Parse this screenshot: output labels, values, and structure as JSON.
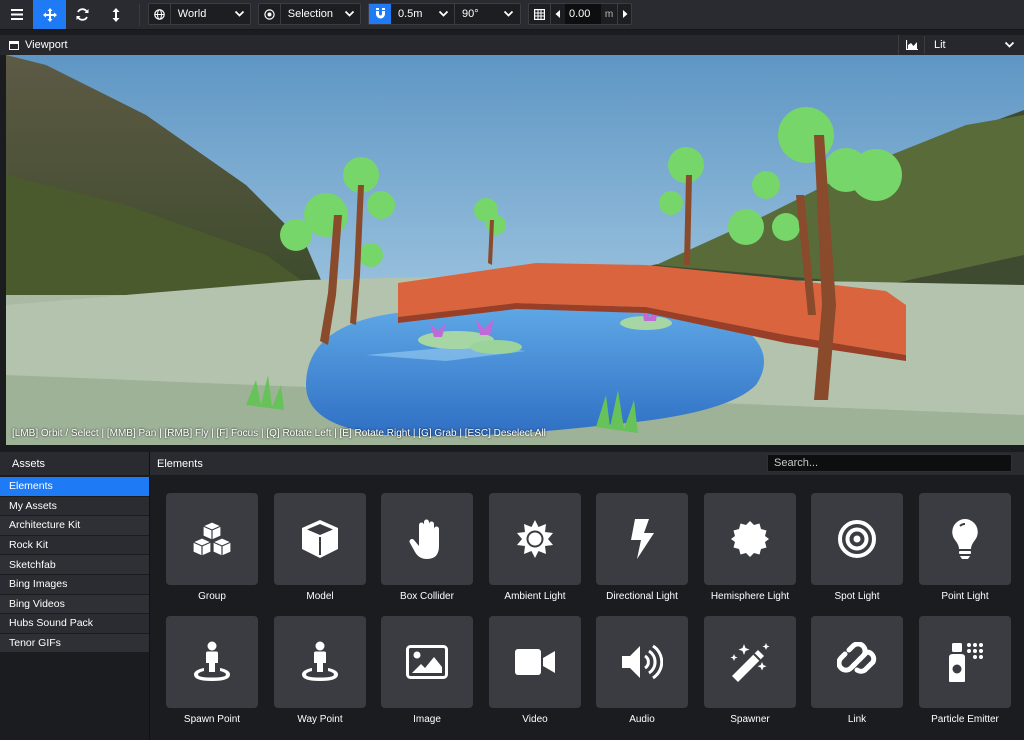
{
  "toolbar": {
    "transform_space": "World",
    "transform_pivot": "Selection",
    "snap_translation": "0.5m",
    "snap_rotation": "90°",
    "grid_height": "0.00",
    "grid_unit": "m"
  },
  "viewport": {
    "title": "Viewport",
    "render_mode": "Lit",
    "hint": "[LMB] Orbit / Select | [MMB] Pan | [RMB] Fly | [F] Focus | [Q] Rotate Left | [E] Rotate Right | [G] Grab | [ESC] Deselect All"
  },
  "assets": {
    "title": "Assets",
    "items": [
      "Elements",
      "My Assets",
      "Architecture Kit",
      "Rock Kit",
      "Sketchfab",
      "Bing Images",
      "Bing Videos",
      "Hubs Sound Pack",
      "Tenor GIFs"
    ],
    "selected": "Elements"
  },
  "elements": {
    "title": "Elements",
    "search_placeholder": "Search...",
    "items": [
      {
        "label": "Group",
        "icon": "cubes-icon"
      },
      {
        "label": "Model",
        "icon": "cube-icon"
      },
      {
        "label": "Box Collider",
        "icon": "hand-icon"
      },
      {
        "label": "Ambient Light",
        "icon": "sun-icon"
      },
      {
        "label": "Directional Light",
        "icon": "bolt-icon"
      },
      {
        "label": "Hemisphere Light",
        "icon": "certificate-icon"
      },
      {
        "label": "Spot Light",
        "icon": "bullseye-icon"
      },
      {
        "label": "Point Light",
        "icon": "lightbulb-icon"
      },
      {
        "label": "Spawn Point",
        "icon": "street-view-icon"
      },
      {
        "label": "Way Point",
        "icon": "street-view-icon"
      },
      {
        "label": "Image",
        "icon": "image-icon"
      },
      {
        "label": "Video",
        "icon": "video-icon"
      },
      {
        "label": "Audio",
        "icon": "volume-up-icon"
      },
      {
        "label": "Spawner",
        "icon": "magic-icon"
      },
      {
        "label": "Link",
        "icon": "link-icon"
      },
      {
        "label": "Particle Emitter",
        "icon": "spray-can-icon"
      }
    ]
  },
  "colors": {
    "accent": "#1e7bf5",
    "panel": "#2a2b30",
    "tile": "#3b3c41",
    "background": "#1b1c20"
  }
}
